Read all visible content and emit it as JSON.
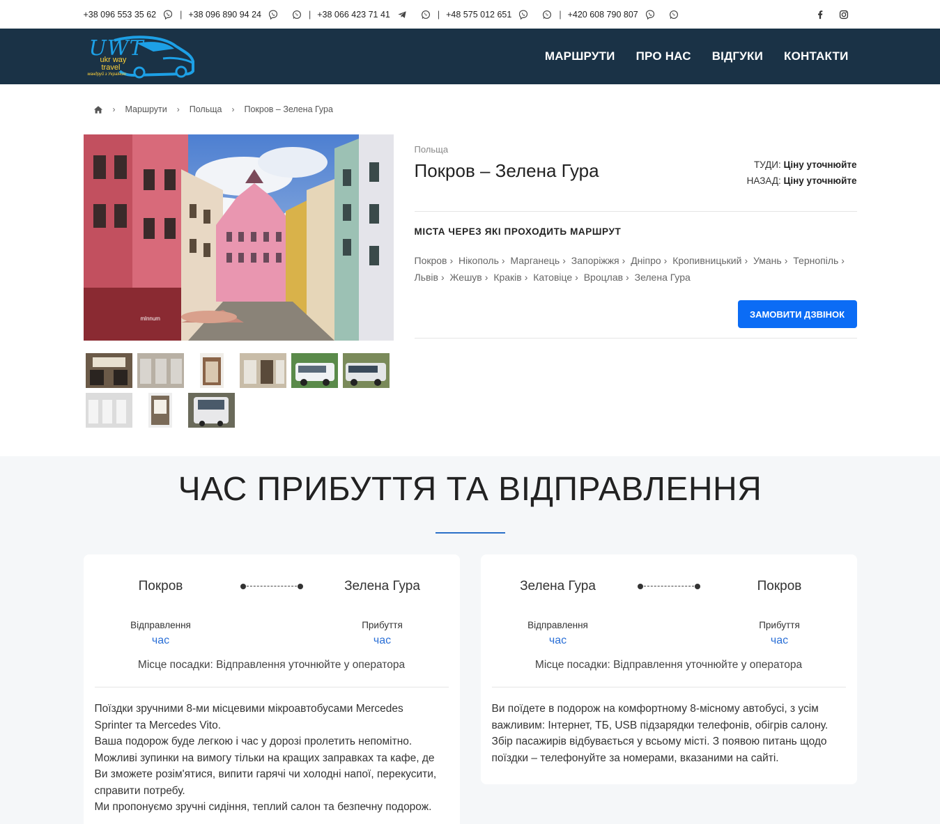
{
  "topbar": {
    "phones": [
      {
        "number": "+38 096 553 35 62",
        "icons": [
          "viber-icon"
        ]
      },
      {
        "number": "+38 096 890 94 24",
        "icons": [
          "viber-icon",
          "whatsapp-icon"
        ]
      },
      {
        "number": "+38 066 423 71 41",
        "icons": [
          "telegram-icon",
          "whatsapp-icon"
        ]
      },
      {
        "number": "+48 575 012 651",
        "icons": [
          "viber-icon",
          "whatsapp-icon"
        ]
      },
      {
        "number": "+420 608 790 807",
        "icons": [
          "viber-icon",
          "whatsapp-icon"
        ]
      }
    ],
    "separator": "|",
    "socials": [
      "facebook-icon",
      "instagram-icon"
    ]
  },
  "header": {
    "logo_text": "UWT",
    "logo_sub1": "ukr way",
    "logo_sub2": "travel",
    "logo_tagline": "мандруй з Україною",
    "nav": [
      "МАРШРУТИ",
      "ПРО НАС",
      "ВІДГУКИ",
      "КОНТАКТИ"
    ]
  },
  "breadcrumb": {
    "items": [
      "Маршрути",
      "Польща",
      "Покров – Зелена Гура"
    ]
  },
  "product": {
    "country": "Польща",
    "title": "Покров – Зелена Гура",
    "price_there_label": "ТУДИ:",
    "price_there_value": "Ціну уточнюйте",
    "price_back_label": "НАЗАД:",
    "price_back_value": "Ціну уточнюйте",
    "cities_heading": "МІСТА ЧЕРЕЗ ЯКІ ПРОХОДИТЬ МАРШРУТ",
    "cities": [
      "Покров",
      "Нікополь",
      "Марганець",
      "Запоріжжя",
      "Дніпро",
      "Кропивницький",
      "Умань",
      "Тернопіль",
      "Львів",
      "Жешув",
      "Краків",
      "Катовіце",
      "Вроцлав",
      "Зелена Гура"
    ],
    "call_button": "ЗАМОВИТИ ДЗВІНОК",
    "main_image_sign": "mlnnum"
  },
  "schedule": {
    "title": "ЧАС ПРИБУТТЯ ТА ВІДПРАВЛЕННЯ",
    "cards": [
      {
        "from": "Покров",
        "to": "Зелена Гура",
        "departure_label": "Відправлення",
        "departure_value": "час",
        "arrival_label": "Прибуття",
        "arrival_value": "час",
        "boarding": "Місце посадки: Відправлення уточнюйте у оператора",
        "description": [
          "Поїздки зручними 8-ми місцевими мікроавтобусами Mercedes Sprinter та Mercedes Vito.",
          "Ваша подорож буде легкою і час у дорозі пролетить непомітно.",
          "Можливі зупинки на вимогу тільки на кращих заправках та кафе, де Ви зможете розім'ятися, випити гарячі чи холодні напої, перекусити, справити потребу.",
          "Ми пропонуємо зручні сидіння, теплий салон та безпечну подорож."
        ]
      },
      {
        "from": "Зелена Гура",
        "to": "Покров",
        "departure_label": "Відправлення",
        "departure_value": "час",
        "arrival_label": "Прибуття",
        "arrival_value": "час",
        "boarding": "Місце посадки: Відправлення уточнюйте у оператора",
        "description": [
          "Ви поїдете в подорож на комфортному 8-місному автобусі, з усім важливим: Інтернет, ТБ, USB підзарядки телефонів, обігрів салону. Збір пасажирів відбувається у всьому місті. З появою питань щодо поїздки – телефонуйте за номерами, вказаними на сайті."
        ]
      }
    ]
  }
}
